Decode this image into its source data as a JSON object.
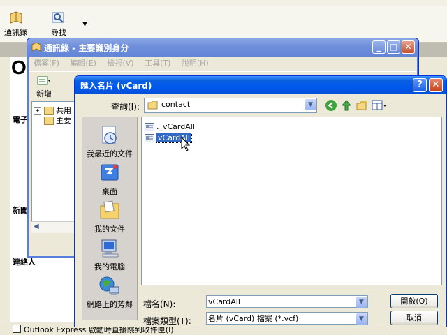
{
  "outlook": {
    "toolbar": {
      "contacts_label": "通訊錄",
      "find_label": "尋找"
    },
    "pane_labels": {
      "email": "電子",
      "news": "新聞",
      "contacts": "連絡人"
    },
    "status_text": "Outlook Express 啟動時直接跳到收件匣(I)"
  },
  "address_book": {
    "title": "通訊錄 - 主要識別身分",
    "menu": [
      "檔案(F)",
      "編輯(E)",
      "檢視(V)",
      "工具(T)",
      "說明(H)"
    ],
    "new_label": "新增",
    "tree": [
      "共用",
      "主要"
    ]
  },
  "dialog": {
    "title": "匯入名片 (vCard)",
    "look_in_label": "查詢(I):",
    "look_in_value": "contact",
    "places": [
      {
        "label": "我最近的文件",
        "icon": "recent-documents-icon"
      },
      {
        "label": "桌面",
        "icon": "desktop-icon"
      },
      {
        "label": "我的文件",
        "icon": "my-documents-icon"
      },
      {
        "label": "我的電腦",
        "icon": "my-computer-icon"
      },
      {
        "label": "網路上的芳鄰",
        "icon": "network-places-icon"
      }
    ],
    "files": [
      {
        "name": "._vCardAll",
        "selected": false
      },
      {
        "name": "vCardAll",
        "selected": true
      }
    ],
    "filename_label": "檔名(N):",
    "filename_value": "vCardAll",
    "filetype_label": "檔案類型(T):",
    "filetype_value": "名片 (vCard) 檔案 (*.vcf)",
    "open_button": "開啟(O)",
    "cancel_button": "取消",
    "help_symbol": "?",
    "close_symbol": "✕"
  },
  "colors": {
    "title_blue": "#0054e3",
    "inactive_title": "#7a96df",
    "selection": "#316ac5"
  }
}
